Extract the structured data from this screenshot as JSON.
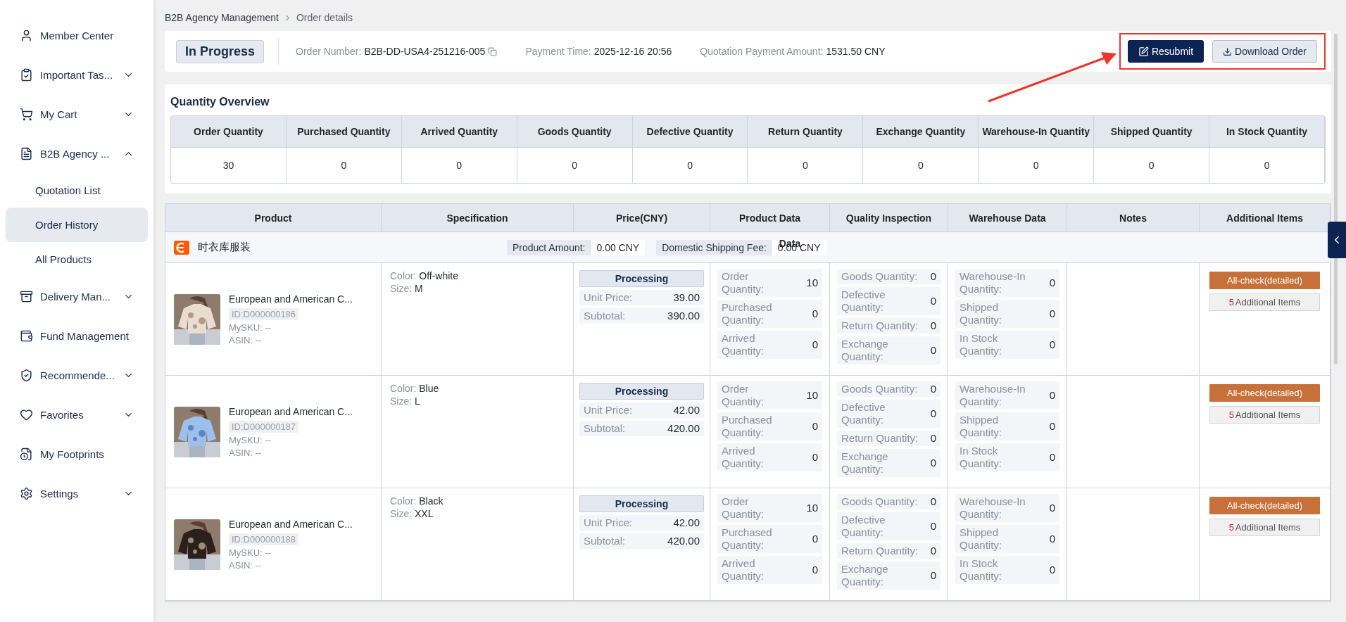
{
  "sidebar": {
    "items": [
      {
        "label": "Member Center"
      },
      {
        "label": "Important Tas...",
        "expanded": false
      },
      {
        "label": "My Cart",
        "expanded": false
      },
      {
        "label": "B2B Agency ...",
        "expanded": true,
        "children": [
          {
            "label": "Quotation List",
            "selected": false
          },
          {
            "label": "Order History",
            "selected": true
          },
          {
            "label": "All Products",
            "selected": false
          }
        ]
      },
      {
        "label": "Delivery Man...",
        "expanded": false
      },
      {
        "label": "Fund Management"
      },
      {
        "label": "Recommende...",
        "expanded": false
      },
      {
        "label": "Favorites",
        "expanded": false
      },
      {
        "label": "My Footprints"
      },
      {
        "label": "Settings",
        "expanded": false
      }
    ]
  },
  "breadcrumb": [
    "B2B Agency Management",
    "Order details"
  ],
  "order": {
    "status": "In Progress",
    "fields": [
      {
        "label": "Order Number:",
        "value": "B2B-DD-USA4-251216-005",
        "copy": true
      },
      {
        "label": "Payment Time:",
        "value": "2025-12-16 20:56",
        "copy": false
      },
      {
        "label": "Quotation Payment Amount:",
        "value": "1531.50 CNY",
        "copy": false
      }
    ],
    "actions": [
      {
        "label": "Resubmit",
        "kind": "primary"
      },
      {
        "label": "Download Order",
        "kind": "secondary"
      }
    ],
    "highlighted": true
  },
  "quantity_overview": {
    "title": "Quantity Overview",
    "columns": [
      "Order Quantity",
      "Purchased Quantity",
      "Arrived Quantity",
      "Goods Quantity",
      "Defective Quantity",
      "Return Quantity",
      "Exchange Quantity",
      "Warehouse-In Quantity",
      "Shipped Quantity",
      "In Stock Quantity"
    ],
    "values": [
      "30",
      "0",
      "0",
      "0",
      "0",
      "0",
      "0",
      "0",
      "0",
      "0"
    ]
  },
  "table": {
    "columns": [
      "Product",
      "Specification",
      "Price(CNY)",
      "Product Data",
      "Quality Inspection",
      "Warehouse Data",
      "Notes",
      "Additional Items"
    ],
    "shop": {
      "name": "时衣库服装",
      "amount_label": "Product Amount:",
      "amount": "0.00 CNY",
      "fee_label": "Domestic Shipping Fee:",
      "fee": "0.00 CNY",
      "overlap_text": "Data"
    },
    "rows": [
      {
        "name": "European and American C...",
        "id": "ID:D000000186",
        "mysku": "MySKU: --",
        "asin": "ASIN: --",
        "spec": [
          {
            "label": "Color:",
            "value": "Off-white"
          },
          {
            "label": "Size:",
            "value": "M"
          }
        ],
        "status": "Processing",
        "prices": [
          {
            "label": "Unit Price:",
            "value": "39.00"
          },
          {
            "label": "Subtotal:",
            "value": "390.00"
          }
        ],
        "product_data": [
          {
            "label": "Order Quantity:",
            "value": "10"
          },
          {
            "label": "Purchased Quantity:",
            "value": "0"
          },
          {
            "label": "Arrived Quantity:",
            "value": "0"
          }
        ],
        "quality": [
          {
            "label": "Goods Quantity:",
            "value": "0"
          },
          {
            "label": "Defective Quantity:",
            "value": "0"
          },
          {
            "label": "Return Quantity:",
            "value": "0"
          },
          {
            "label": "Exchange Quantity:",
            "value": "0"
          }
        ],
        "warehouse": [
          {
            "label": "Warehouse-In Quantity:",
            "value": "0"
          },
          {
            "label": "Shipped Quantity:",
            "value": "0"
          },
          {
            "label": "In Stock Quantity:",
            "value": "0"
          }
        ],
        "check": "All-check(detailed)",
        "extra_count": "5",
        "extra_label": "Additional Items"
      },
      {
        "name": "European and American C...",
        "id": "ID:D000000187",
        "mysku": "MySKU: --",
        "asin": "ASIN: --",
        "spec": [
          {
            "label": "Color:",
            "value": "Blue"
          },
          {
            "label": "Size:",
            "value": "L"
          }
        ],
        "status": "Processing",
        "prices": [
          {
            "label": "Unit Price:",
            "value": "42.00"
          },
          {
            "label": "Subtotal:",
            "value": "420.00"
          }
        ],
        "product_data": [
          {
            "label": "Order Quantity:",
            "value": "10"
          },
          {
            "label": "Purchased Quantity:",
            "value": "0"
          },
          {
            "label": "Arrived Quantity:",
            "value": "0"
          }
        ],
        "quality": [
          {
            "label": "Goods Quantity:",
            "value": "0"
          },
          {
            "label": "Defective Quantity:",
            "value": "0"
          },
          {
            "label": "Return Quantity:",
            "value": "0"
          },
          {
            "label": "Exchange Quantity:",
            "value": "0"
          }
        ],
        "warehouse": [
          {
            "label": "Warehouse-In Quantity:",
            "value": "0"
          },
          {
            "label": "Shipped Quantity:",
            "value": "0"
          },
          {
            "label": "In Stock Quantity:",
            "value": "0"
          }
        ],
        "check": "All-check(detailed)",
        "extra_count": "5",
        "extra_label": "Additional Items"
      },
      {
        "name": "European and American C...",
        "id": "ID:D000000188",
        "mysku": "MySKU: --",
        "asin": "ASIN: --",
        "spec": [
          {
            "label": "Color:",
            "value": "Black"
          },
          {
            "label": "Size:",
            "value": "XXL"
          }
        ],
        "status": "Processing",
        "prices": [
          {
            "label": "Unit Price:",
            "value": "42.00"
          },
          {
            "label": "Subtotal:",
            "value": "420.00"
          }
        ],
        "product_data": [
          {
            "label": "Order Quantity:",
            "value": "10"
          },
          {
            "label": "Purchased Quantity:",
            "value": "0"
          },
          {
            "label": "Arrived Quantity:",
            "value": "0"
          }
        ],
        "quality": [
          {
            "label": "Goods Quantity:",
            "value": "0"
          },
          {
            "label": "Defective Quantity:",
            "value": "0"
          },
          {
            "label": "Return Quantity:",
            "value": "0"
          },
          {
            "label": "Exchange Quantity:",
            "value": "0"
          }
        ],
        "warehouse": [
          {
            "label": "Warehouse-In Quantity:",
            "value": "0"
          },
          {
            "label": "Shipped Quantity:",
            "value": "0"
          },
          {
            "label": "In Stock Quantity:",
            "value": "0"
          }
        ],
        "check": "All-check(detailed)",
        "extra_count": "5",
        "extra_label": "Additional Items"
      }
    ]
  }
}
